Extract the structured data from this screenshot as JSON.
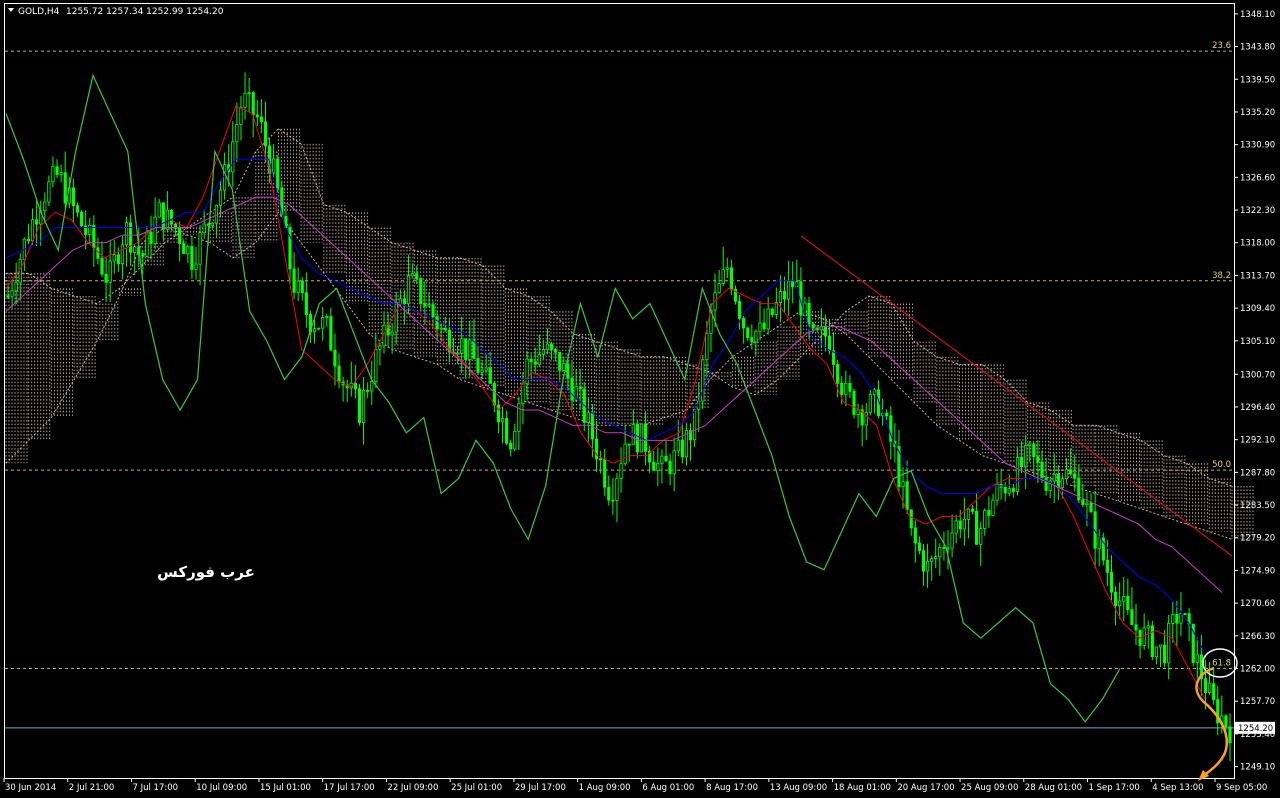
{
  "header": {
    "symbol": "GOLD,H4",
    "ohlc": "1255.72 1257.34 1252.99 1254.20"
  },
  "watermark": "عرب فوركس",
  "colors": {
    "background": "#000000",
    "candles": "#00ff00",
    "fib_lines": "#c8b44a",
    "tenkan": "#ff0000",
    "kijun": "#0000ff",
    "chikou": "#3cc83c",
    "ma": "#c83cc8",
    "kumo": "#ffdcc8",
    "trendline": "#d01010",
    "forecast_arrow": "#ffa020",
    "price_line": "#8aa0c8"
  },
  "chart_data": {
    "type": "candlestick",
    "symbol": "GOLD",
    "timeframe": "H4",
    "ylim": [
      1247.6,
      1349.4
    ],
    "y_ticks": [
      "1348.10",
      "1343.80",
      "1339.50",
      "1335.20",
      "1330.90",
      "1326.60",
      "1322.30",
      "1318.00",
      "1313.70",
      "1309.40",
      "1305.10",
      "1300.70",
      "1296.40",
      "1292.10",
      "1287.80",
      "1283.50",
      "1279.20",
      "1274.90",
      "1270.60",
      "1266.30",
      "1262.00",
      "1257.70",
      "1253.40",
      "1249.10"
    ],
    "x_labels": [
      "30 Jun 2014",
      "2 Jul 21:00",
      "7 Jul 17:00",
      "10 Jul 09:00",
      "15 Jul 01:00",
      "17 Jul 17:00",
      "22 Jul 09:00",
      "25 Jul 01:00",
      "29 Jul 17:00",
      "1 Aug 09:00",
      "6 Aug 01:00",
      "8 Aug 17:00",
      "13 Aug 09:00",
      "18 Aug 01:00",
      "20 Aug 17:00",
      "25 Aug 09:00",
      "28 Aug 01:00",
      "1 Sep 17:00",
      "4 Sep 13:00",
      "9 Sep 05:00"
    ],
    "current_price": "1254.20",
    "fib_levels": [
      {
        "label": "23.6",
        "value": 1343.2
      },
      {
        "label": "38.2",
        "value": 1313.0
      },
      {
        "label": "50.0",
        "value": 1288.1
      },
      {
        "label": "61.8",
        "value": 1262.0
      }
    ],
    "close_series": [
      1311,
      1318,
      1324,
      1327,
      1322,
      1318,
      1313,
      1320,
      1316,
      1322,
      1320,
      1316,
      1321,
      1327,
      1337,
      1334,
      1326,
      1313,
      1308,
      1307,
      1300,
      1296,
      1303,
      1308,
      1313,
      1310,
      1306,
      1305,
      1302,
      1298,
      1292,
      1302,
      1304,
      1302,
      1298,
      1292,
      1285,
      1293,
      1292,
      1288,
      1290,
      1294,
      1309,
      1315,
      1307,
      1306,
      1310,
      1313,
      1305,
      1306,
      1298,
      1296,
      1297,
      1290,
      1279,
      1275,
      1279,
      1282,
      1280,
      1285,
      1287,
      1290,
      1287,
      1288,
      1286,
      1279,
      1273,
      1268,
      1266,
      1264,
      1270,
      1263,
      1257,
      1254.2
    ],
    "series": [
      {
        "name": "Tenkan",
        "values": [
          1312,
          1315,
          1320,
          1322,
          1321,
          1318,
          1316,
          1317,
          1318,
          1320,
          1321,
          1320,
          1324,
          1330,
          1336,
          1335,
          1328,
          1316,
          1304,
          1302,
          1300,
          1299,
          1302,
          1306,
          1310,
          1309,
          1307,
          1304,
          1302,
          1299,
          1296,
          1298,
          1301,
          1300,
          1298,
          1293,
          1290,
          1289,
          1290,
          1290,
          1292,
          1293,
          1300,
          1310,
          1312,
          1311,
          1310,
          1310,
          1307,
          1304,
          1302,
          1297,
          1296,
          1294,
          1287,
          1282,
          1281,
          1282,
          1282,
          1284,
          1286,
          1287,
          1287,
          1287,
          1286,
          1282,
          1277,
          1272,
          1268,
          1266,
          1267,
          1266,
          1262,
          1258
        ]
      },
      {
        "name": "Kijun",
        "values": [
          1316,
          1317,
          1318,
          1320,
          1320,
          1320,
          1320,
          1320,
          1320,
          1320,
          1321,
          1322,
          1322,
          1326,
          1329,
          1329,
          1329,
          1320,
          1316,
          1314,
          1313,
          1312,
          1311,
          1310,
          1310,
          1309,
          1308,
          1307,
          1306,
          1304,
          1302,
          1300,
          1300,
          1300,
          1299,
          1297,
          1295,
          1294,
          1293,
          1292,
          1293,
          1294,
          1296,
          1302,
          1305,
          1309,
          1311,
          1313,
          1313,
          1306,
          1304,
          1303,
          1301,
          1298,
          1292,
          1288,
          1286,
          1285,
          1285,
          1285,
          1286,
          1286,
          1287,
          1287,
          1286,
          1284,
          1281,
          1278,
          1276,
          1274,
          1273,
          1271,
          1268,
          1264
        ]
      },
      {
        "name": "MA",
        "values": [
          1309,
          1311,
          1313,
          1315,
          1317,
          1318,
          1318,
          1319,
          1319,
          1320,
          1320,
          1320,
          1321,
          1322,
          1323,
          1324,
          1324,
          1323,
          1321,
          1319,
          1317,
          1315,
          1313,
          1311,
          1309,
          1307,
          1305,
          1303,
          1301,
          1299,
          1297,
          1296,
          1296,
          1295,
          1294,
          1294,
          1293,
          1293,
          1292,
          1292,
          1292,
          1293,
          1294,
          1296,
          1298,
          1300,
          1302,
          1304,
          1306,
          1307,
          1307,
          1306,
          1305,
          1303,
          1301,
          1299,
          1297,
          1295,
          1293,
          1291,
          1289,
          1288,
          1287,
          1286,
          1285,
          1284,
          1283,
          1282,
          1281,
          1279,
          1278,
          1276,
          1274,
          1272
        ]
      },
      {
        "name": "Chikou",
        "values": [
          1335,
          1329,
          1322,
          1317,
          1330,
          1340,
          1335,
          1330,
          1310,
          1300,
          1296,
          1300,
          1330,
          1325,
          1309,
          1305,
          1300,
          1303,
          1310,
          1312,
          1306,
          1300,
          1297,
          1293,
          1295,
          1285,
          1287,
          1292,
          1289,
          1283,
          1279,
          1286,
          1300,
          1310,
          1303,
          1312,
          1308,
          1310,
          1305,
          1300,
          1312,
          1306,
          1302,
          1296,
          1290,
          1282,
          1276,
          1275,
          1280,
          1285,
          1282,
          1287,
          1288,
          1282,
          1278,
          1268,
          1266,
          1268,
          1270,
          1268,
          1260,
          1258,
          1255,
          1258,
          1262
        ]
      }
    ],
    "kumo_top": [
      1314,
      1314,
      1312,
      1311,
      1310,
      1312,
      1315,
      1318,
      1320,
      1322,
      1324,
      1330,
      1333,
      1331,
      1323,
      1322,
      1320,
      1318,
      1317,
      1316,
      1316,
      1315,
      1312,
      1311,
      1309,
      1306,
      1305,
      1304,
      1303,
      1303,
      1302,
      1301,
      1299,
      1298,
      1300,
      1303,
      1306,
      1309,
      1311,
      1310,
      1305,
      1303,
      1302,
      1302,
      1300,
      1297,
      1296,
      1294,
      1294,
      1293,
      1292,
      1290,
      1289,
      1287,
      1286
    ],
    "kumo_bottom": [
      1289,
      1292,
      1295,
      1300,
      1305,
      1311,
      1318,
      1320,
      1319,
      1318,
      1316,
      1318,
      1322,
      1318,
      1314,
      1310,
      1306,
      1304,
      1303,
      1302,
      1300,
      1299,
      1298,
      1297,
      1296,
      1295,
      1294,
      1294,
      1294,
      1295,
      1296,
      1300,
      1303,
      1305,
      1307,
      1309,
      1308,
      1306,
      1303,
      1300,
      1297,
      1294,
      1292,
      1290,
      1289,
      1288,
      1287,
      1286,
      1285,
      1284,
      1283,
      1282,
      1281,
      1280,
      1279
    ],
    "trendline": [
      [
        1318.9,
        "13 Aug"
      ],
      [
        1276.8,
        "9 Sep"
      ]
    ]
  }
}
